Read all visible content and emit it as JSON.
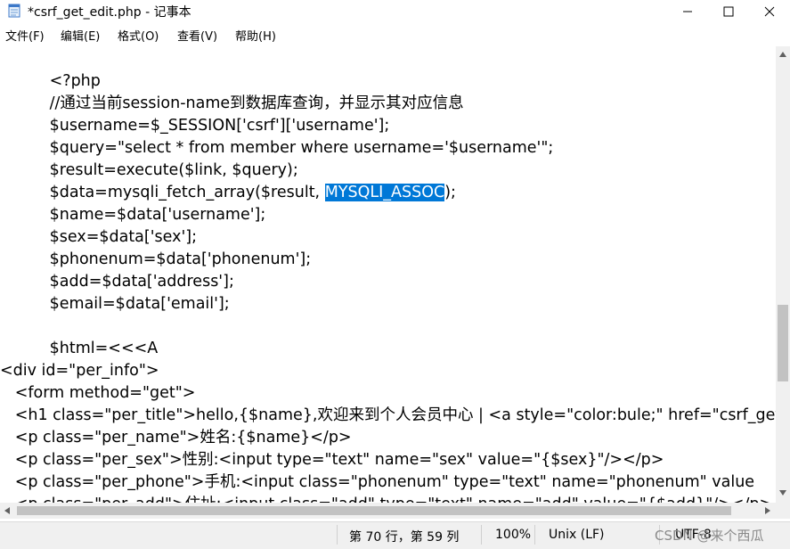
{
  "window": {
    "title": "*csrf_get_edit.php - 记事本",
    "minimize_glyph": "—",
    "maximize_glyph": "☐",
    "close_glyph": "✕"
  },
  "menu": [
    "文件(F)",
    "编辑(E)",
    "格式(O)",
    "查看(V)",
    "帮助(H)"
  ],
  "editor": {
    "lines": [
      "          <?php",
      "          //通过当前session-name到数据库查询，并显示其对应信息",
      "          $username=$_SESSION['csrf']['username'];",
      "          $query=\"select * from member where username='$username'\";",
      "          $result=execute($link, $query);",
      "          $data=mysqli_fetch_array($result, ",
      "          $name=$data['username'];",
      "          $sex=$data['sex'];",
      "          $phonenum=$data['phonenum'];",
      "          $add=$data['address'];",
      "          $email=$data['email'];",
      "",
      "          $html=<<<A",
      "<div id=\"per_info\">",
      "   <form method=\"get\">",
      "   <h1 class=\"per_title\">hello,{$name},欢迎来到个人会员中心 | <a style=\"color:bule;\" href=\"csrf_get",
      "   <p class=\"per_name\">姓名:{$name}</p>",
      "   <p class=\"per_sex\">性别:<input type=\"text\" name=\"sex\" value=\"{$sex}\"/></p>",
      "   <p class=\"per_phone\">手机:<input class=\"phonenum\" type=\"text\" name=\"phonenum\" value",
      "   <p class=\"per_add\">住址:<input class=\"add\" type=\"text\" name=\"add\" value=\"{$add}\"/></p>"
    ],
    "selection_line": 5,
    "selected_text": "MYSQLI_ASSOC",
    "after_selection": ");"
  },
  "status": {
    "position": "第 70 行，第 59 列",
    "zoom": "100%",
    "line_ending": "Unix (LF)",
    "encoding": "UTF-8"
  },
  "watermark": "CSDN @来个西瓜",
  "colors": {
    "selection": "#0078d7",
    "statusbar": "#f0f0f0"
  }
}
